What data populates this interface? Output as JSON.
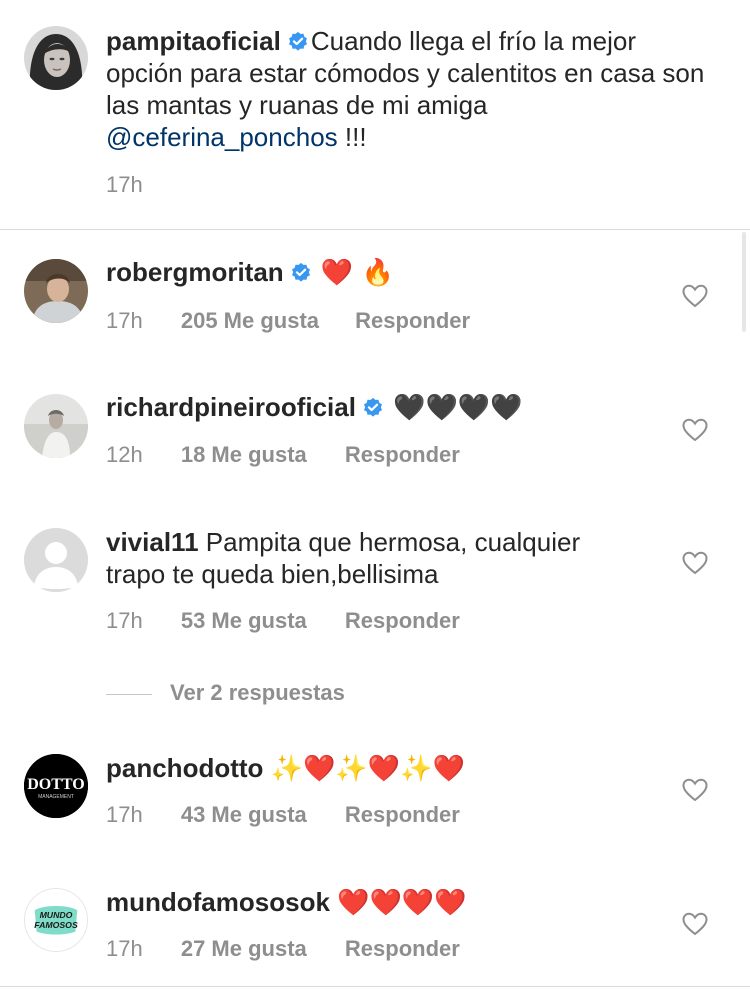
{
  "caption": {
    "username": "pampitaoficial",
    "text_before": "Cuando  llega el frío la mejor opción para estar cómodos y calentitos en casa son las mantas y ruanas de mi amiga ",
    "mention": "@ceferina_ponchos",
    "text_after": " !!!",
    "time": "17h"
  },
  "comments": [
    {
      "username": "robergmoritan",
      "verified": true,
      "text": "❤️ 🔥",
      "time": "17h",
      "likes": "205 Me gusta",
      "reply": "Responder"
    },
    {
      "username": "richardpineirooficial",
      "verified": true,
      "text": "🖤🖤🖤🖤",
      "time": "12h",
      "likes": "18 Me gusta",
      "reply": "Responder"
    },
    {
      "username": "vivial11",
      "verified": false,
      "text": "Pampita que hermosa, cualquier trapo te queda bien,bellisima",
      "time": "17h",
      "likes": "53 Me gusta",
      "reply": "Responder"
    },
    {
      "username": "panchodotto",
      "verified": false,
      "text": "✨❤️✨❤️✨❤️",
      "time": "17h",
      "likes": "43 Me gusta",
      "reply": "Responder"
    },
    {
      "username": "mundofamososok",
      "verified": false,
      "text": "❤️❤️❤️❤️",
      "time": "17h",
      "likes": "27 Me gusta",
      "reply": "Responder"
    }
  ],
  "view_replies": "Ver 2 respuestas",
  "avatars": {
    "dotto_logo": "DOTTO",
    "dotto_sub": "MANAGEMENT",
    "mundo_logo_line1": "MUNDO",
    "mundo_logo_line2": "FAMOSOS"
  },
  "colors": {
    "text": "#262626",
    "meta": "#8e8e8e",
    "mention": "#003569",
    "verified": "#3897f0",
    "heart_red": "#ed1f32",
    "divider": "#dbdbdb"
  },
  "icons": {
    "verified": "verified-badge-icon",
    "like": "heart-outline-icon"
  }
}
